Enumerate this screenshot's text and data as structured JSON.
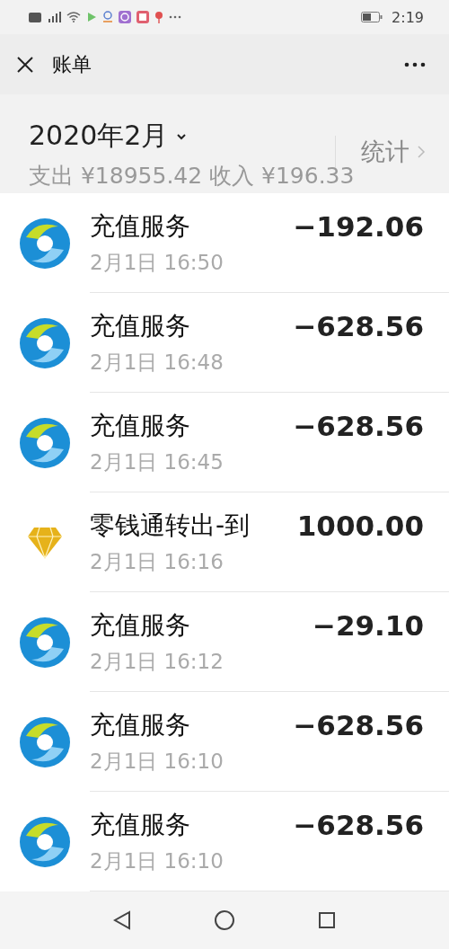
{
  "status_bar": {
    "time": "2:19"
  },
  "header": {
    "title": "账单"
  },
  "summary": {
    "month": "2020年2月",
    "stats_link": "统计",
    "totals": "支出 ¥18955.42 收入 ¥196.33"
  },
  "transactions": [
    {
      "kind": "recharge",
      "title": "充值服务",
      "time": "2月1日 16:50",
      "amount": "−192.06"
    },
    {
      "kind": "recharge",
      "title": "充值服务",
      "time": "2月1日 16:48",
      "amount": "−628.56"
    },
    {
      "kind": "recharge",
      "title": "充值服务",
      "time": "2月1日 16:45",
      "amount": "−628.56"
    },
    {
      "kind": "diamond",
      "title": "零钱通转出-到",
      "time": "2月1日 16:16",
      "amount": "1000.00"
    },
    {
      "kind": "recharge",
      "title": "充值服务",
      "time": "2月1日 16:12",
      "amount": "−29.10"
    },
    {
      "kind": "recharge",
      "title": "充值服务",
      "time": "2月1日 16:10",
      "amount": "−628.56"
    },
    {
      "kind": "recharge",
      "title": "充值服务",
      "time": "2月1日 16:10",
      "amount": "−628.56"
    }
  ]
}
